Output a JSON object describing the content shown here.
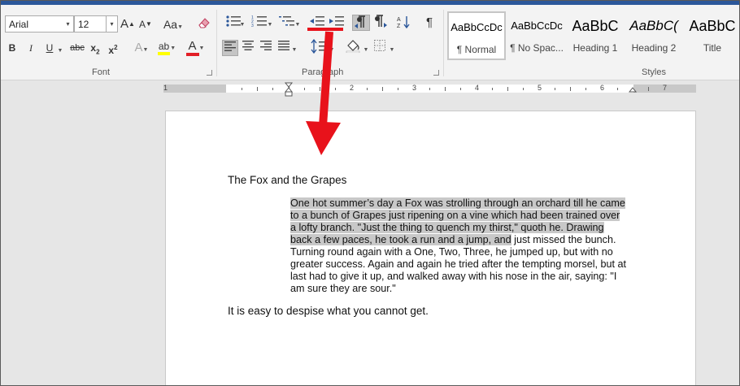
{
  "font": {
    "family_value": "Arial",
    "size_value": "12",
    "grow_label": "A",
    "shrink_label": "A",
    "case_label": "Aa",
    "bold": "B",
    "italic": "I",
    "underline": "U",
    "strike": "abc",
    "subscript": "x",
    "sub_mark": "2",
    "superscript": "x",
    "sup_mark": "2",
    "text_effects": "A",
    "highlight": "ab",
    "font_color": "A",
    "group_label": "Font"
  },
  "paragraph": {
    "group_label": "Paragraph",
    "show_marks": "¶"
  },
  "styles": {
    "group_label": "Styles",
    "items": [
      {
        "preview": "AaBbCcDc",
        "name": "¶ Normal"
      },
      {
        "preview": "AaBbCcDc",
        "name": "¶ No Spac..."
      },
      {
        "preview": "AaBbC",
        "name": "Heading 1"
      },
      {
        "preview": "AaBbC(",
        "name": "Heading 2"
      },
      {
        "preview": "AaBbC",
        "name": "Title"
      }
    ]
  },
  "ruler": {
    "numbers": [
      "1",
      "1",
      "2",
      "3",
      "4",
      "5",
      "6",
      "7"
    ]
  },
  "document": {
    "title": "The Fox and the Grapes",
    "paragraph_lines": [
      "One hot summer’s day a Fox was strolling through an orchard till he came",
      "to a bunch of Grapes just ripening on a vine which had been trained over",
      "a lofty branch. \"Just the thing to quench my thirst,\" quoth he.   Drawing",
      "back a few paces, he took a run and a jump, and",
      " just missed the bunch.",
      "Turning round again with a One, Two, Three, he jumped up, but with no",
      "greater success. Again and again he tried after the tempting morsel, but at",
      "last had to give it up, and walked away with his nose in the air, saying: \"I",
      "am sure they are sour.\""
    ],
    "closing": "It is easy to despise what you cannot get."
  },
  "colors": {
    "title_bar": "#2b579a",
    "annotation_red": "#e8121b",
    "selection_highlight": "#c8c8c8",
    "highlight_yellow": "#ffff00",
    "font_color_red": "#e21e26"
  }
}
